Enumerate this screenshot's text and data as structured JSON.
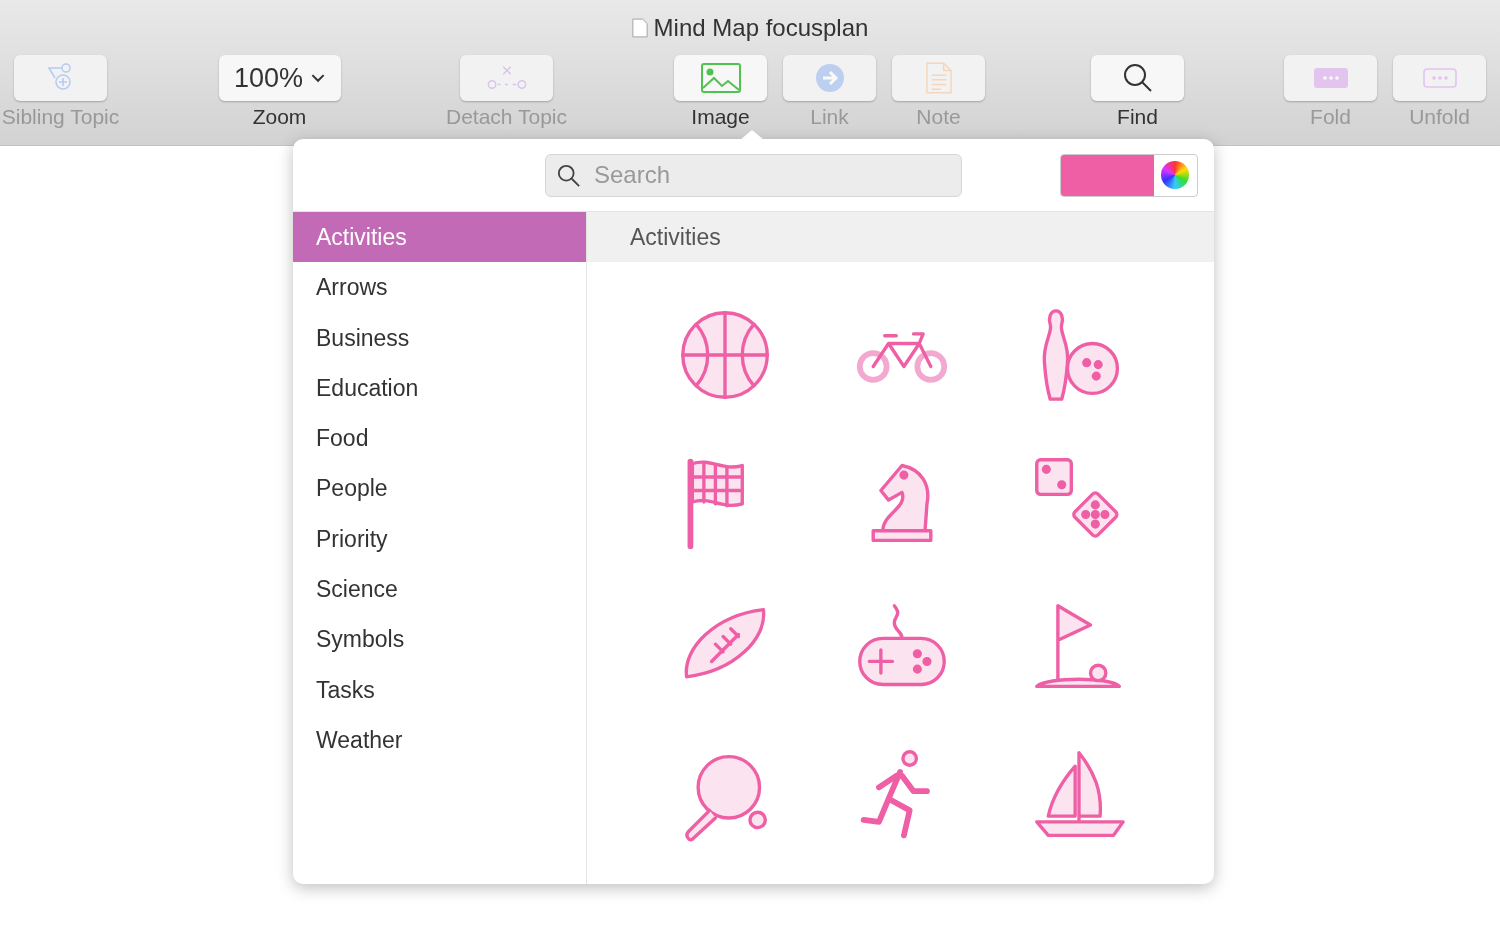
{
  "window": {
    "title": "Mind Map focusplan"
  },
  "toolbar": [
    {
      "label": "Sibling Topic",
      "kind": "button",
      "disabled": true
    },
    {
      "label": "Zoom",
      "kind": "dropdown",
      "value": "100%",
      "disabled": false
    },
    {
      "label": "Detach Topic",
      "kind": "button",
      "disabled": true
    },
    {
      "label": "Image",
      "kind": "button",
      "disabled": false
    },
    {
      "label": "Link",
      "kind": "button",
      "disabled": true
    },
    {
      "label": "Note",
      "kind": "button",
      "disabled": true
    },
    {
      "label": "Find",
      "kind": "button",
      "disabled": false
    },
    {
      "label": "Fold",
      "kind": "button",
      "disabled": true
    },
    {
      "label": "Unfold",
      "kind": "button",
      "disabled": true
    }
  ],
  "popover": {
    "search": {
      "placeholder": "Search"
    },
    "color": "#ee5fa5",
    "categories": [
      {
        "label": "Activities",
        "selected": true
      },
      {
        "label": "Arrows",
        "selected": false
      },
      {
        "label": "Business",
        "selected": false
      },
      {
        "label": "Education",
        "selected": false
      },
      {
        "label": "Food",
        "selected": false
      },
      {
        "label": "People",
        "selected": false
      },
      {
        "label": "Priority",
        "selected": false
      },
      {
        "label": "Science",
        "selected": false
      },
      {
        "label": "Symbols",
        "selected": false
      },
      {
        "label": "Tasks",
        "selected": false
      },
      {
        "label": "Weather",
        "selected": false
      }
    ],
    "header": "Activities"
  }
}
